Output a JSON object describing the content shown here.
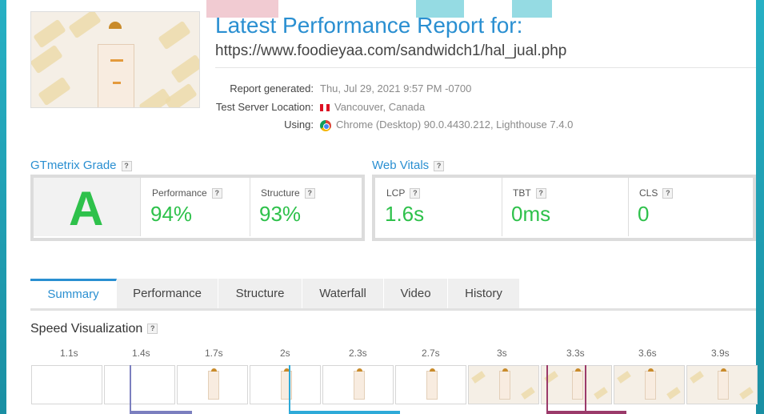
{
  "header": {
    "title": "Latest Performance Report for:",
    "url": "https://www.foodieyaa.com/sandwidch1/hal_jual.php",
    "meta": [
      {
        "label": "Report generated:",
        "value": "Thu, Jul 29, 2021 9:57 PM -0700",
        "icon": "none"
      },
      {
        "label": "Test Server Location:",
        "value": "Vancouver, Canada",
        "icon": "canada-flag-icon"
      },
      {
        "label": "Using:",
        "value": "Chrome (Desktop) 90.0.4430.212, Lighthouse 7.4.0",
        "icon": "chrome-icon"
      }
    ]
  },
  "grade": {
    "heading": "GTmetrix Grade",
    "letter": "A",
    "metrics": [
      {
        "label": "Performance",
        "value": "94%"
      },
      {
        "label": "Structure",
        "value": "93%"
      }
    ]
  },
  "vitals": {
    "heading": "Web Vitals",
    "metrics": [
      {
        "label": "LCP",
        "value": "1.6s"
      },
      {
        "label": "TBT",
        "value": "0ms"
      },
      {
        "label": "CLS",
        "value": "0"
      }
    ]
  },
  "help_mark": "?",
  "tabs": [
    "Summary",
    "Performance",
    "Structure",
    "Waterfall",
    "Video",
    "History"
  ],
  "active_tab": "Summary",
  "speed": {
    "title": "Speed Visualization",
    "ticks": [
      "1.1s",
      "1.4s",
      "1.7s",
      "2s",
      "2.3s",
      "2.7s",
      "3s",
      "3.3s",
      "3.6s",
      "3.9s"
    ]
  },
  "colors": {
    "accent": "#2a8fd1",
    "grade_green": "#2ec14b",
    "marker_purple": "#7b7fbf",
    "marker_blue": "#2eaad8",
    "marker_maroon": "#9b3a6a"
  }
}
